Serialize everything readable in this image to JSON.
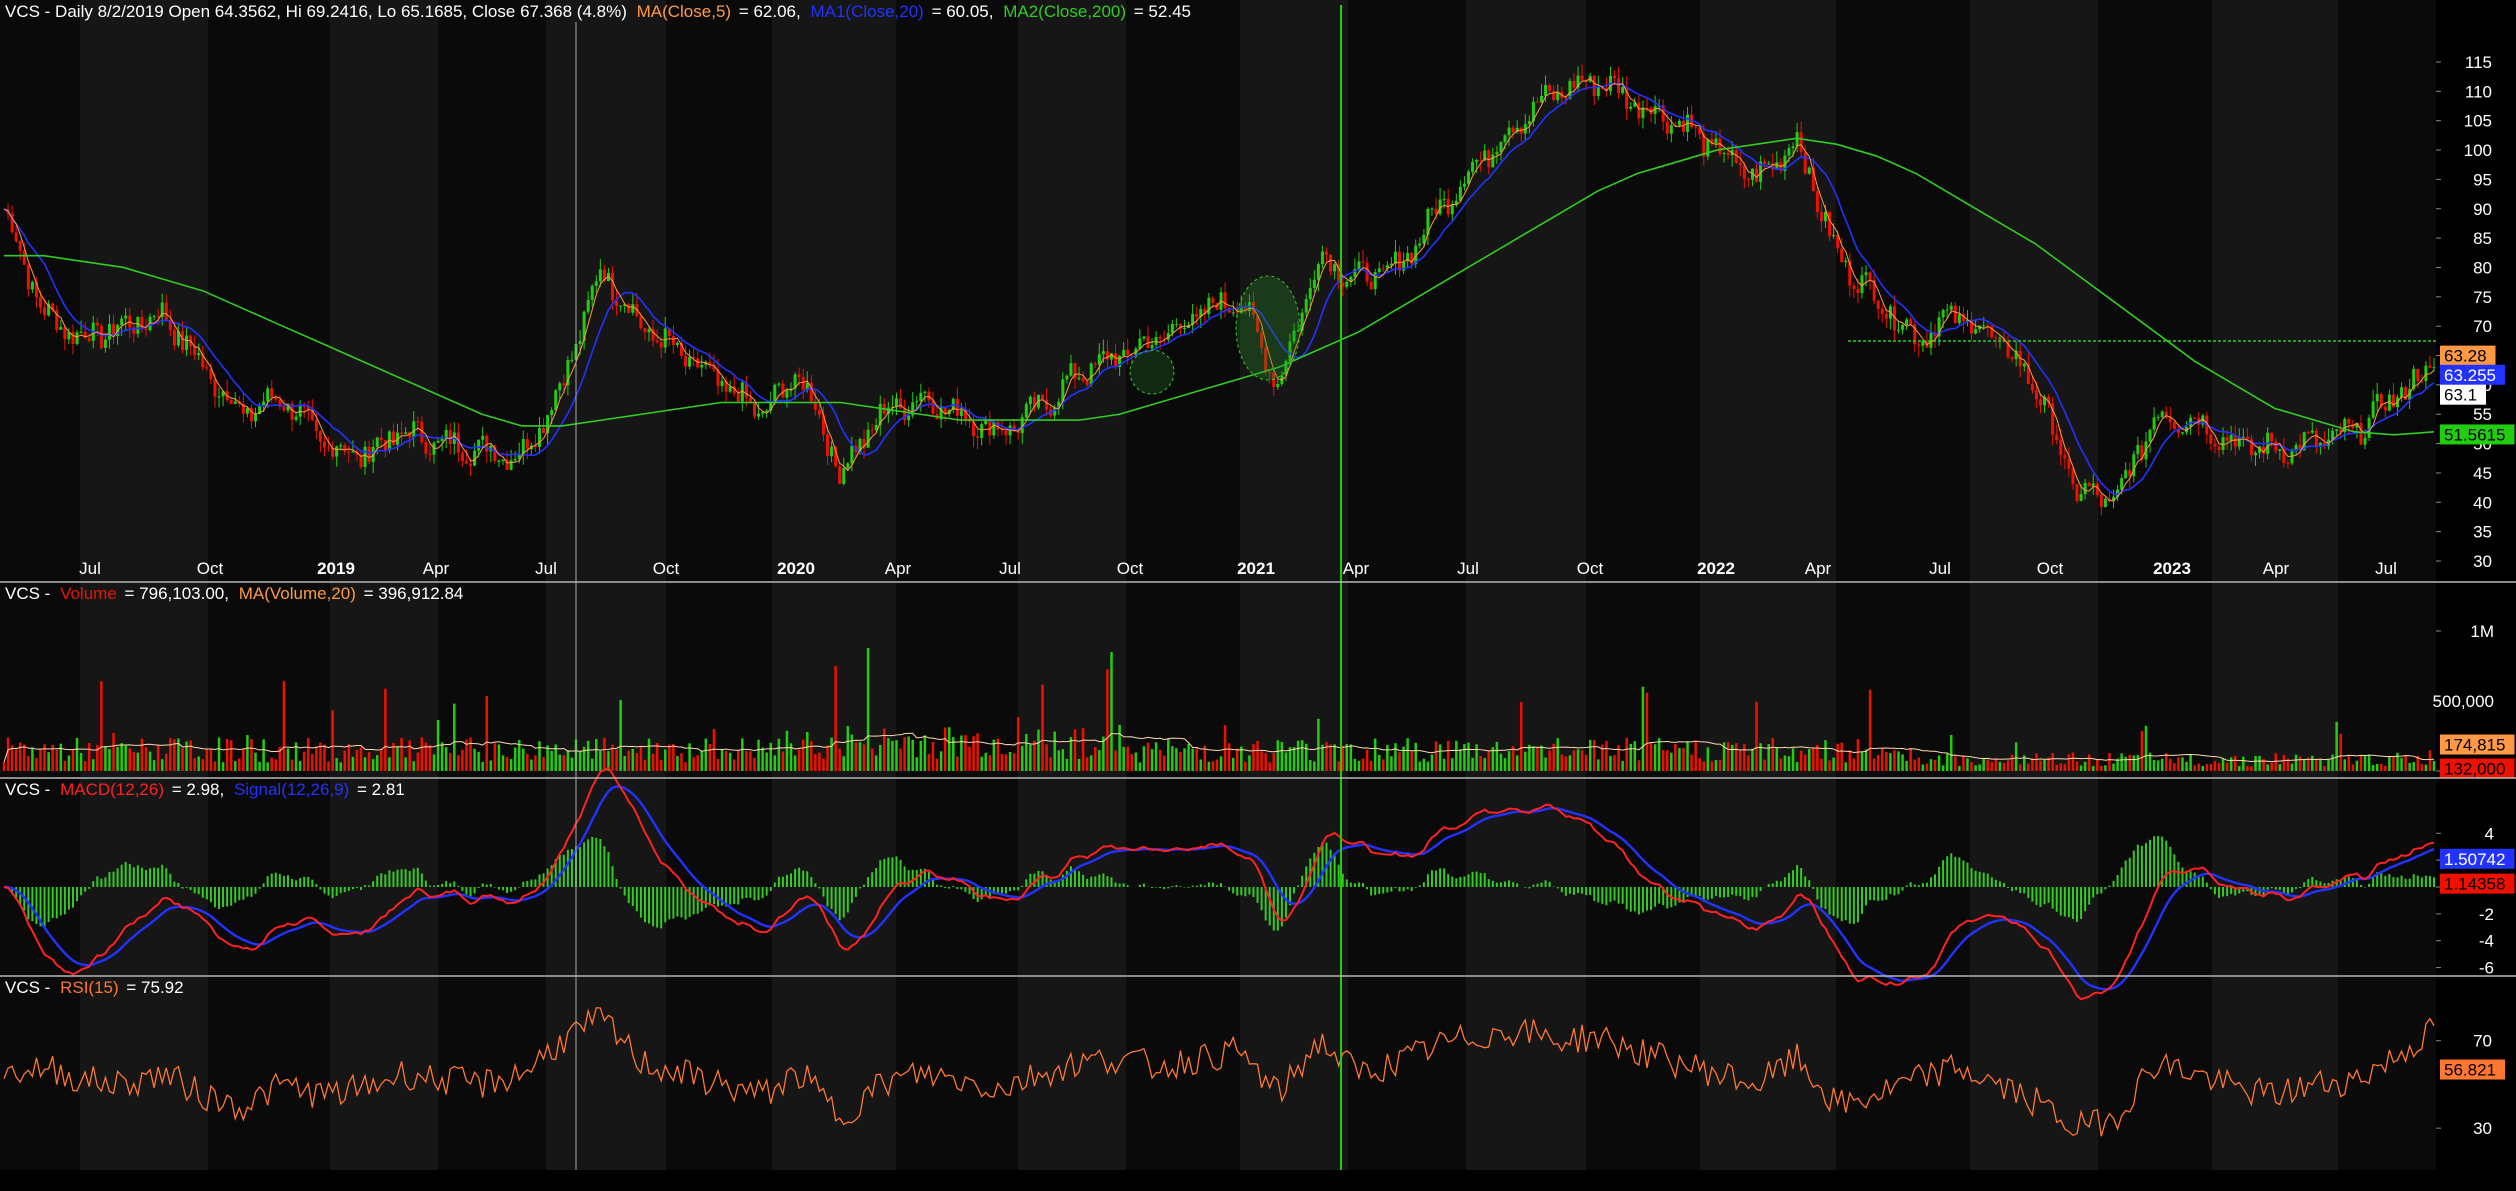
{
  "colors": {
    "bg": "#000000",
    "panel": "#0e0e0e",
    "band_dark": "#0a0a0a",
    "band_light": "#161616",
    "grid": "#2a2a2a",
    "text": "#ffffff",
    "up": "#22cc11",
    "down": "#ee1100",
    "ma5": "#ff9944",
    "ma20": "#2233ff",
    "ma200": "#33cc22",
    "macd": "#ff2222",
    "signal": "#2233ff",
    "hist": "#33cc22",
    "rsi": "#ff7733"
  },
  "price_panel": {
    "header": {
      "ticker_prefix": "VCS - Daily 8/2/2019 Open 64.3562, Hi 69.2416, Lo 65.1685, Close 67.368 (4.8%)",
      "ma5_label": "MA(Close,5)",
      "ma5_value": "= 62.06,",
      "ma20_label": "MA1(Close,20)",
      "ma20_value": "= 60.05,",
      "ma200_label": "MA2(Close,200)",
      "ma200_value": "= 52.45"
    },
    "yticks": [
      "30",
      "35",
      "40",
      "45",
      "50",
      "55",
      "60",
      "65",
      "70",
      "75",
      "80",
      "85",
      "90",
      "95",
      "100",
      "105",
      "110",
      "115"
    ],
    "badges": [
      {
        "text": "63.28",
        "bg": "#ff9944",
        "fg": "#000000"
      },
      {
        "text": "63.255",
        "bg": "#2233ff",
        "fg": "#ffffff"
      },
      {
        "text": "63.1",
        "bg": "#ffffff",
        "fg": "#000000"
      },
      {
        "text": "51.5615",
        "bg": "#22cc11",
        "fg": "#000000"
      }
    ],
    "xticks": [
      {
        "label": "Jul",
        "bold": false
      },
      {
        "label": "Oct",
        "bold": false
      },
      {
        "label": "2019",
        "bold": true
      },
      {
        "label": "Apr",
        "bold": false
      },
      {
        "label": "Jul",
        "bold": false
      },
      {
        "label": "Oct",
        "bold": false
      },
      {
        "label": "2020",
        "bold": true
      },
      {
        "label": "Apr",
        "bold": false
      },
      {
        "label": "Jul",
        "bold": false
      },
      {
        "label": "Oct",
        "bold": false
      },
      {
        "label": "2021",
        "bold": true
      },
      {
        "label": "Apr",
        "bold": false
      },
      {
        "label": "Jul",
        "bold": false
      },
      {
        "label": "Oct",
        "bold": false
      },
      {
        "label": "2022",
        "bold": true
      },
      {
        "label": "Apr",
        "bold": false
      },
      {
        "label": "Jul",
        "bold": false
      },
      {
        "label": "Oct",
        "bold": false
      },
      {
        "label": "2023",
        "bold": true
      },
      {
        "label": "Apr",
        "bold": false
      },
      {
        "label": "Jul",
        "bold": false
      }
    ]
  },
  "volume_panel": {
    "header": {
      "prefix": "VCS -",
      "vol_label": "Volume",
      "vol_value": "= 796,103.00,",
      "ma_label": "MA(Volume,20)",
      "ma_value": "= 396,912.84"
    },
    "yticks": [
      "0",
      "500,000",
      "1M"
    ],
    "badges": [
      {
        "text": "174,815",
        "bg": "#ff9944",
        "fg": "#000000"
      },
      {
        "text": "132,000",
        "bg": "#ee1100",
        "fg": "#000000"
      }
    ]
  },
  "macd_panel": {
    "header": {
      "prefix": "VCS -",
      "macd_label": "MACD(12,26)",
      "macd_value": "= 2.98,",
      "signal_label": "Signal(12,26,9)",
      "signal_value": "= 2.81"
    },
    "yticks": [
      "-6",
      "-4",
      "-2",
      "0",
      "2",
      "4"
    ],
    "badges": [
      {
        "text": "1.50742",
        "bg": "#2233ff",
        "fg": "#ffffff"
      },
      {
        "text": "1.14358",
        "bg": "#ee1100",
        "fg": "#000000"
      }
    ]
  },
  "rsi_panel": {
    "header": {
      "prefix": "VCS -",
      "rsi_label": "RSI(15)",
      "rsi_value": "= 75.92"
    },
    "yticks": [
      "30",
      "70"
    ],
    "badges": [
      {
        "text": "56.821",
        "bg": "#ff7733",
        "fg": "#000000"
      }
    ]
  },
  "chart_data": {
    "type": "line",
    "ticker": "VCS",
    "x_dates": [
      "2018-06",
      "2018-07",
      "2018-08",
      "2018-09",
      "2018-10",
      "2018-11",
      "2018-12",
      "2019-01",
      "2019-02",
      "2019-03",
      "2019-04",
      "2019-05",
      "2019-06",
      "2019-07",
      "2019-08",
      "2019-09",
      "2019-10",
      "2019-11",
      "2019-12",
      "2020-01",
      "2020-02",
      "2020-03",
      "2020-04",
      "2020-05",
      "2020-06",
      "2020-07",
      "2020-08",
      "2020-09",
      "2020-10",
      "2020-11",
      "2020-12",
      "2021-01",
      "2021-02",
      "2021-03",
      "2021-04",
      "2021-05",
      "2021-06",
      "2021-07",
      "2021-08",
      "2021-09",
      "2021-10",
      "2021-11",
      "2021-12",
      "2022-01",
      "2022-02",
      "2022-03",
      "2022-04",
      "2022-05",
      "2022-06",
      "2022-07",
      "2022-08",
      "2022-09",
      "2022-10",
      "2022-11",
      "2022-12",
      "2023-01",
      "2023-02",
      "2023-03",
      "2023-04",
      "2023-05",
      "2023-06",
      "2023-07"
    ],
    "series": [
      {
        "name": "Close",
        "values": [
          90,
          72,
          68,
          70,
          72,
          63,
          55,
          58,
          50,
          48,
          52,
          50,
          49,
          48,
          60,
          80,
          70,
          65,
          60,
          55,
          62,
          45,
          55,
          58,
          55,
          52,
          56,
          62,
          65,
          68,
          72,
          75,
          60,
          82,
          78,
          80,
          90,
          98,
          105,
          110,
          112,
          108,
          105,
          100,
          95,
          102,
          82,
          75,
          68,
          72,
          68,
          60,
          42,
          40,
          55,
          54,
          50,
          49,
          50,
          52,
          58,
          63
        ]
      },
      {
        "name": "MA2(Close,200)",
        "values": [
          82,
          82,
          81,
          80,
          78,
          76,
          73,
          70,
          67,
          64,
          61,
          58,
          55,
          53,
          53,
          54,
          55,
          56,
          57,
          57,
          57,
          57,
          56,
          55,
          54,
          54,
          54,
          54,
          55,
          57,
          59,
          61,
          63,
          66,
          69,
          73,
          77,
          81,
          85,
          89,
          93,
          96,
          98,
          100,
          101,
          102,
          101,
          99,
          96,
          92,
          88,
          84,
          79,
          74,
          69,
          64,
          60,
          56,
          54,
          52,
          51.5,
          52
        ]
      },
      {
        "name": "RSI(15)",
        "values": [
          55,
          58,
          52,
          50,
          55,
          45,
          40,
          50,
          45,
          48,
          55,
          52,
          50,
          55,
          70,
          80,
          60,
          55,
          50,
          45,
          55,
          35,
          50,
          55,
          52,
          48,
          55,
          60,
          62,
          58,
          62,
          65,
          45,
          70,
          55,
          60,
          68,
          72,
          75,
          70,
          72,
          65,
          60,
          55,
          50,
          62,
          40,
          45,
          52,
          58,
          50,
          42,
          30,
          35,
          60,
          55,
          48,
          45,
          50,
          52,
          62,
          75
        ]
      }
    ]
  }
}
